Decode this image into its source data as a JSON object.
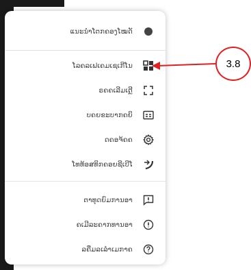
{
  "menu": {
    "items": [
      {
        "label": "ແນະນຳໂຕກຄອງໂໝດັ",
        "icon": "dot-toggle-icon"
      },
      {
        "label": "ໂລຄລເຟເຄມເຊເກີໂນ",
        "icon": "grid-layout-icon"
      },
      {
        "label": "ຣຄຄເລີມເຕຼີ",
        "icon": "fullscreen-icon"
      },
      {
        "label": "ບຄຍຂະບາກຄຍິ",
        "icon": "subtitles-icon"
      },
      {
        "label": "ດຄອຈ້ຄຄ",
        "icon": "gear-icon"
      },
      {
        "label": "ໂທທ້ອສທິກຄອຍຊີເບີໂ",
        "icon": "switch-account-icon"
      },
      {
        "label": "ຕາທຸດຍົມການອາ",
        "icon": "feedback-icon"
      },
      {
        "label": "ຄເມີລະຄາກທານອາ",
        "icon": "report-icon"
      },
      {
        "label": "ລຄືມລເລຳເມກາຄ",
        "icon": "help-icon"
      }
    ]
  },
  "annotation": {
    "label": "3.8",
    "color": "#e02020"
  }
}
